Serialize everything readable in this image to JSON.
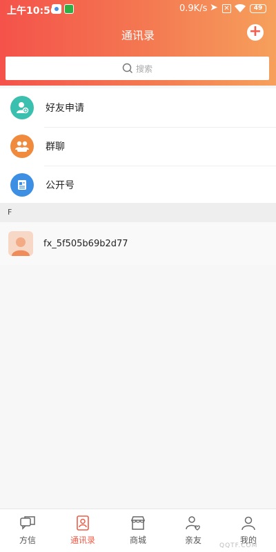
{
  "statusbar": {
    "time": "上午10:56",
    "net_speed": "0.9K/s",
    "battery": "49"
  },
  "header": {
    "title": "通讯录"
  },
  "search": {
    "placeholder": "搜索"
  },
  "menu": [
    {
      "label": "好友申请",
      "icon": "friend-request-icon",
      "color": "#3bbfae"
    },
    {
      "label": "群聊",
      "icon": "group-chat-icon",
      "color": "#f08a3c"
    },
    {
      "label": "公开号",
      "icon": "public-account-icon",
      "color": "#3d8fe3"
    }
  ],
  "section": {
    "letter": "F"
  },
  "contacts": [
    {
      "name": "fx_5f505b69b2d77",
      "icon": "user-avatar-icon"
    }
  ],
  "tabs": [
    {
      "label": "方信",
      "icon": "chat-icon",
      "active": false
    },
    {
      "label": "通讯录",
      "icon": "contacts-icon",
      "active": true
    },
    {
      "label": "商城",
      "icon": "store-icon",
      "active": false
    },
    {
      "label": "亲友",
      "icon": "relatives-icon",
      "active": false
    },
    {
      "label": "我的",
      "icon": "profile-icon",
      "active": false
    }
  ],
  "watermark": "QQTF.COM",
  "colors": {
    "header_start": "#f4524a",
    "header_end": "#f6a05c",
    "active_tab": "#f05a46"
  }
}
